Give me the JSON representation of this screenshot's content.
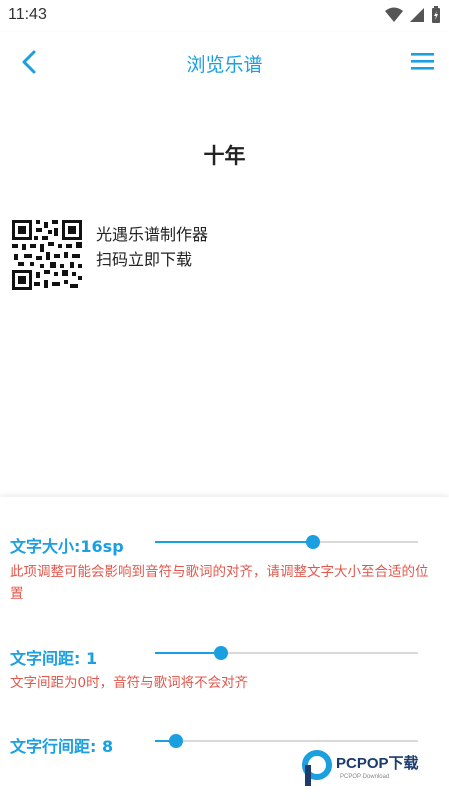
{
  "status_bar": {
    "time": "11:43"
  },
  "header": {
    "title": "浏览乐谱"
  },
  "sheet": {
    "title": "十年",
    "promo_line1": "光遇乐谱制作器",
    "promo_line2": "扫码立即下载"
  },
  "settings": {
    "text_size": {
      "label": "文字大小:16sp",
      "value_fraction": 0.6,
      "note": "此项调整可能会影响到音符与歌词的对齐，请调整文字大小至合适的位置"
    },
    "text_spacing": {
      "label": "文字间距: 1",
      "value_fraction": 0.25,
      "note": "文字间距为0时，音符与歌词将不会对齐"
    },
    "line_spacing": {
      "label": "文字行间距: 8",
      "value_fraction": 0.08
    }
  },
  "watermark": {
    "brand": "PCPOP下载",
    "sub": "PCPOP Download"
  },
  "colors": {
    "accent": "#1a9fe0",
    "warning": "#e2574c",
    "track": "#d9d9d9"
  }
}
